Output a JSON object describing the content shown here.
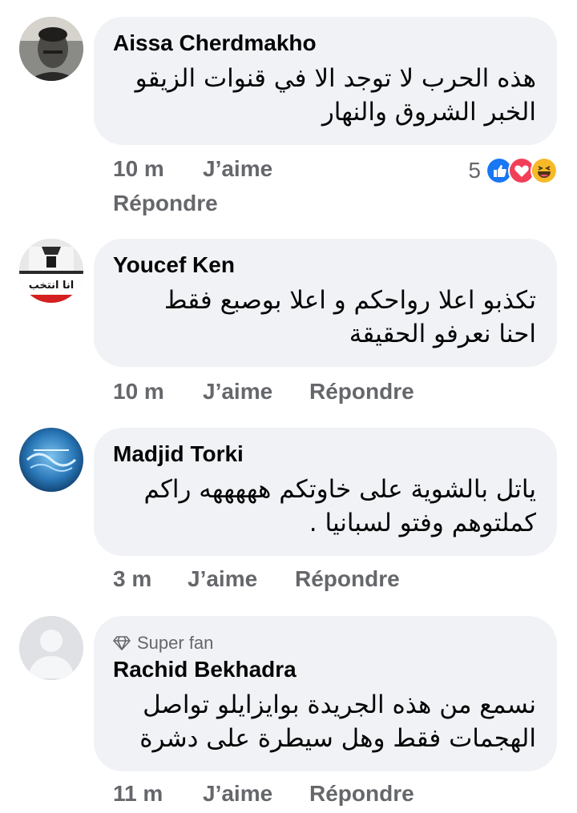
{
  "comments": [
    {
      "author": "Aissa Cherdmakho",
      "text_lines": [
        "هذه الحرب لا توجد الا في قنوات الزيقو",
        "الخبر الشروق والنهار"
      ],
      "time": "10 m",
      "like_label": "J’aime",
      "reply_label": "Répondre",
      "reaction_count": "5",
      "reactions": [
        "like-icon",
        "love-icon",
        "haha-icon"
      ]
    },
    {
      "author": "Youcef Ken",
      "text_lines": [
        "تكذبو اعلا رواحكم و اعلا بوصبع فقط",
        "احنا نعرفو الحقيقة"
      ],
      "time": "10 m",
      "like_label": "J’aime",
      "reply_label": "Répondre",
      "avatar_caption": "انا انتخب"
    },
    {
      "author": "Madjid Torki",
      "text_lines": [
        "ياتل بالشوية على خاوتكم هههههه راكم",
        "كملتوهم وفتو لسبانيا ."
      ],
      "time": "3 m",
      "like_label": "J’aime",
      "reply_label": "Répondre"
    },
    {
      "badge": "Super fan",
      "author": "Rachid Bekhadra",
      "text_lines": [
        "نسمع من هذه الجريدة  بوايزايلو تواصل",
        "الهجمات فقط وهل سيطرة على دشرة"
      ],
      "time": "11 m",
      "like_label": "J’aime",
      "reply_label": "Répondre"
    }
  ],
  "colors": {
    "bubble": "#f0f2f5",
    "meta_text": "#65676b",
    "like_blue": "#1877f2",
    "love_red": "#f33e58",
    "haha_yellow": "#f7b928"
  }
}
